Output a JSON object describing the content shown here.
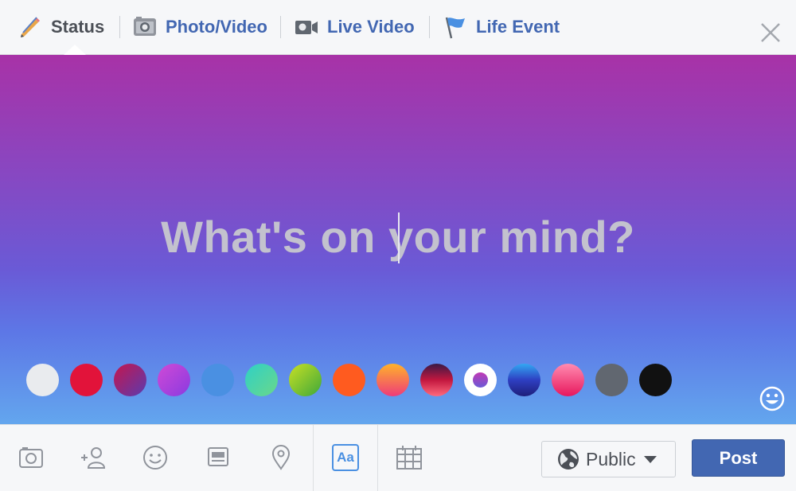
{
  "tabs": [
    {
      "label": "Status",
      "icon": "pencil-icon",
      "active": true
    },
    {
      "label": "Photo/Video",
      "icon": "camera-icon",
      "active": false
    },
    {
      "label": "Live Video",
      "icon": "video-camera-icon",
      "active": false
    },
    {
      "label": "Life Event",
      "icon": "flag-icon",
      "active": false
    }
  ],
  "composer": {
    "placeholder": "What's on your mind?",
    "background_colors": [
      {
        "name": "white",
        "color": "#e9ebee"
      },
      {
        "name": "red",
        "color": "#e2133a"
      },
      {
        "name": "crimson-purple",
        "color": "#8c2a8f"
      },
      {
        "name": "purple",
        "color": "#a63ad6"
      },
      {
        "name": "blue",
        "color": "#4a90e2"
      },
      {
        "name": "teal",
        "color": "#33ccb6"
      },
      {
        "name": "lime",
        "color": "#8bc34a"
      },
      {
        "name": "orange",
        "color": "#ff5722"
      },
      {
        "name": "sunset",
        "color": "#f7a12c"
      },
      {
        "name": "dark-red",
        "color": "#7b1a3a"
      },
      {
        "name": "purple-blue-selected",
        "color": "#6a5ad6",
        "selected": true
      },
      {
        "name": "blue-navy",
        "color": "#3f51b5"
      },
      {
        "name": "pink",
        "color": "#f2427a"
      },
      {
        "name": "gray",
        "color": "#616770"
      },
      {
        "name": "black",
        "color": "#111111"
      }
    ]
  },
  "toolbar": {
    "tools": [
      "photo-icon",
      "tag-people-icon",
      "feeling-icon",
      "gif-icon",
      "location-icon",
      "text-background-icon",
      "event-icon"
    ],
    "text_tool_label": "Aa",
    "audience_label": "Public",
    "post_label": "Post"
  },
  "colors": {
    "accent": "#4267b2",
    "link_blue": "#4a90e2",
    "tab_bar_bg": "#f6f7f9"
  }
}
